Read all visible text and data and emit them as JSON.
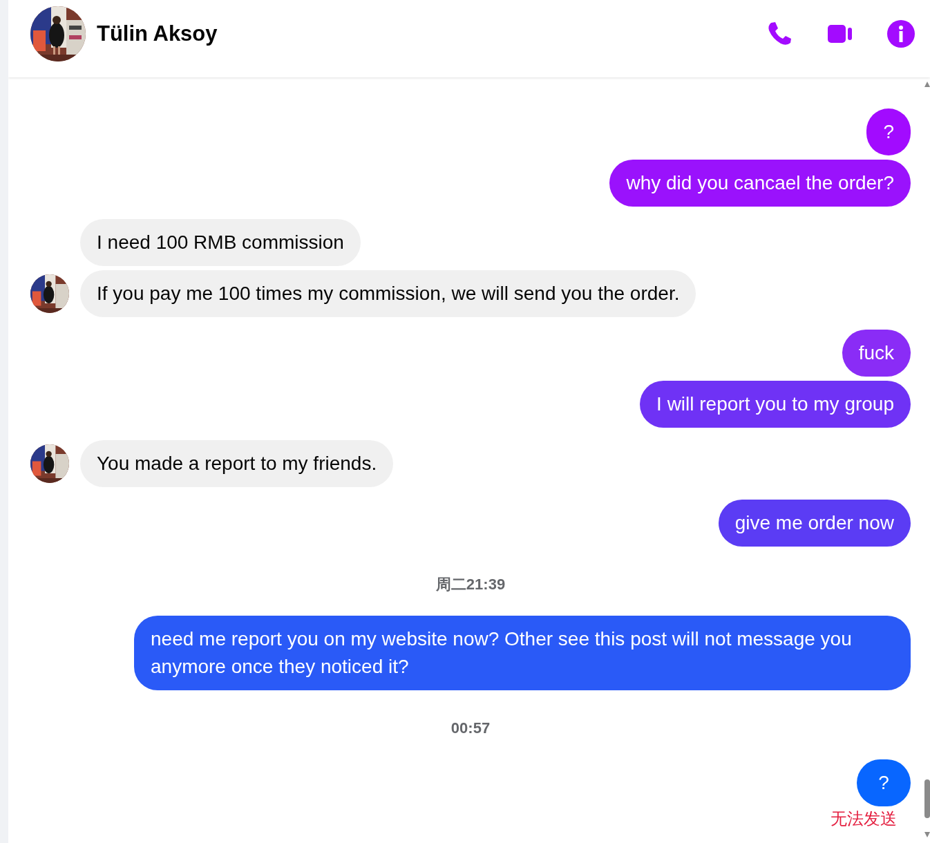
{
  "header": {
    "name": "Tülin Aksoy"
  },
  "messages": [
    {
      "kind": "sent",
      "text": "?",
      "color": "#a20bff"
    },
    {
      "kind": "sent",
      "text": "why did you cancael the order?",
      "color": "#9a12fc"
    },
    {
      "kind": "received",
      "text": "I need 100 RMB commission",
      "avatar": false
    },
    {
      "kind": "received",
      "text": "If you pay me 100 times my commission, we will send you the order.",
      "avatar": true
    },
    {
      "kind": "sent",
      "text": "fuck",
      "color": "#8a2cf6"
    },
    {
      "kind": "sent",
      "text": "I will report you to my group",
      "color": "#6f32f5"
    },
    {
      "kind": "received",
      "text": "You made a report to my friends.",
      "avatar": true
    },
    {
      "kind": "sent",
      "text": "give me order now",
      "color": "#5b3cf4"
    },
    {
      "kind": "timestamp",
      "text": "周二21:39"
    },
    {
      "kind": "sent",
      "text": "need me report you on my website now? Other see this post will not message you anymore once they noticed it?",
      "color": "#2a5af7"
    },
    {
      "kind": "timestamp",
      "text": "00:57"
    },
    {
      "kind": "failed",
      "text": "?",
      "color": "#0866ff",
      "status": "无法发送"
    }
  ]
}
